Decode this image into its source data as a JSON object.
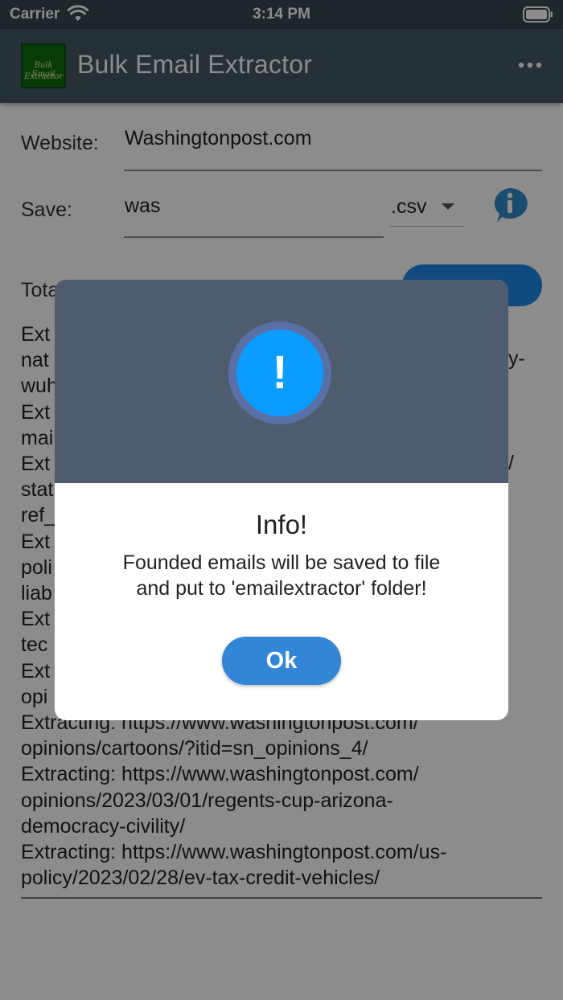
{
  "status_bar": {
    "carrier": "Carrier",
    "time": "3:14 PM"
  },
  "app_bar": {
    "title": "Bulk Email Extractor",
    "logo_text": [
      "Bulk Email",
      "Extractor"
    ]
  },
  "form": {
    "website_label": "Website:",
    "website_value": "Washingtonpost.com",
    "save_label": "Save:",
    "save_value": "was",
    "extension": ".csv",
    "total_label": "Tota"
  },
  "log_lines": [
    "Ext",
    "nat",
    "wuh",
    "Ext",
    "mai",
    "Ext",
    "stat",
    "ref_",
    "Ext",
    "poli",
    "liab",
    "Ext",
    "tec",
    "Ext",
    "opi",
    "Extracting: https://www.washingtonpost.com/",
    "opinions/cartoons/?itid=sn_opinions_4/",
    "Extracting: https://www.washingtonpost.com/",
    "opinions/2023/03/01/regents-cup-arizona-",
    "democracy-civility/",
    "Extracting: https://www.washingtonpost.com/us-",
    "policy/2023/02/28/ev-tax-credit-vehicles/"
  ],
  "log_fragments": {
    "right_1": "y-",
    "right_2": "/"
  },
  "dialog": {
    "icon": "!",
    "title": "Info!",
    "message_line1": "Founded emails will be saved to file",
    "message_line2": "and put to 'emailextractor' folder!",
    "ok_label": "Ok"
  },
  "colors": {
    "app_bar": "#455a64",
    "dialog_header": "#4f5b6e",
    "alert_icon": "#0b9cff",
    "ok_button": "#3385d6",
    "start_button": "#1e88e5"
  }
}
